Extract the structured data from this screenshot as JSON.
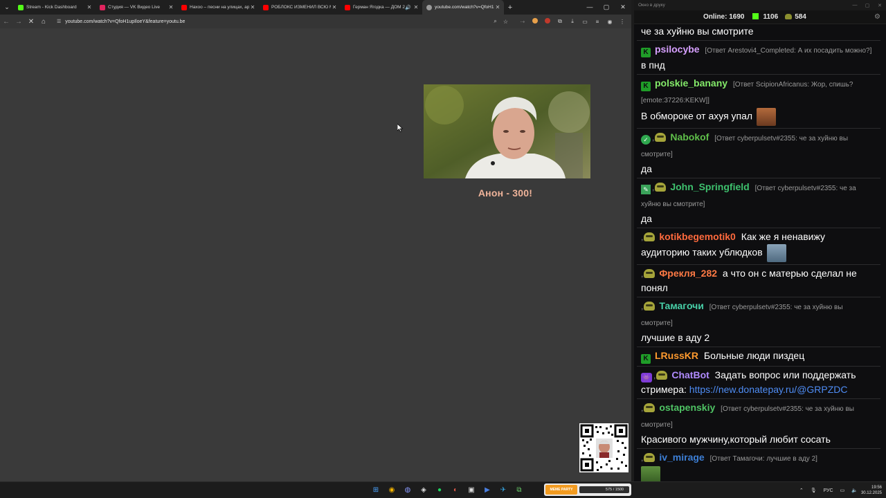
{
  "browser": {
    "tabs": [
      {
        "label": "Stream - Kick Dashboard",
        "favicon_color": "#53fc18"
      },
      {
        "label": "Студия — VK Видео Live",
        "favicon_color": "#e0245e"
      },
      {
        "label": "Нахоо – песни на улицах, арс…",
        "favicon_color": "#ff0000"
      },
      {
        "label": "РОБЛОКС ИЗМЕНИЛ ВСЮ МО…",
        "favicon_color": "#ff0000"
      },
      {
        "label": "Герман Ягодка — ДОМ 2 …",
        "favicon_color": "#ff0000"
      },
      {
        "label": "youtube.com/watch?v=QfoH1…",
        "favicon_color": "#9a9a9a"
      }
    ],
    "url": "youtube.com/watch?v=QfoH1upIloeY&feature=youtu.be",
    "video_caption": "Анон - 300!"
  },
  "chat": {
    "window_title": "Окно в друку",
    "online_label": "Online:",
    "online_count": "1690",
    "kick_count": "1106",
    "frog_count": "584",
    "messages": [
      {
        "text": "че за хуйню вы смотрите"
      },
      {
        "nick": "psilocybe",
        "color": "#d7a0ff",
        "reply": "[Ответ Arestovi4_Completed: А их посадить можно?]",
        "text": "в пнд"
      },
      {
        "nick": "polskie_banany",
        "color": "#84ea6a",
        "reply": "[Ответ ScipionAfricanus: Жор, спишь? [emote:37226:KEKW]]",
        "text": "В обмороке от ахуя упал"
      },
      {
        "nick": "Nabokof",
        "color": "#5fbf4a",
        "reply": "[Ответ cyberpulsetv#2355: че за хуйню вы смотрите]",
        "text": "да"
      },
      {
        "nick": "John_Springfield",
        "color": "#3ec16e",
        "reply": "[Ответ cyberpulsetv#2355: че за хуйню вы смотрите]",
        "text": "да"
      },
      {
        "nick": "kotikbegemotik0",
        "color": "#ff6a3d",
        "text": "Как же я ненавижу аудиторию таких ублюдков"
      },
      {
        "nick": "Фрекля_282",
        "color": "#ff7a45",
        "text": "а что он с матерью сделал не понял"
      },
      {
        "nick": "Тамагочи",
        "color": "#48d0a8",
        "reply": "[Ответ cyberpulsetv#2355: че за хуйню вы смотрите]",
        "text": "лучшие в аду 2"
      },
      {
        "nick": "LRussKR",
        "color": "#ff9a2e",
        "text": "Больные люди пиздец"
      },
      {
        "nick": "ChatBot",
        "color": "#b18cff",
        "text": "Задать вопрос или поддержать стримера:",
        "link": "https://new.donatepay.ru/@GRPZDC"
      },
      {
        "nick": "ostapenskiy",
        "color": "#4fc364",
        "reply": "[Ответ cyberpulsetv#2355: че за хуйню вы смотрите]",
        "text": "Красивого мужчину,который любит сосать"
      },
      {
        "nick": "iv_mirage",
        "color": "#3d7fd6",
        "reply": "[Ответ Тамагочи: лучшие в аду 2]"
      }
    ]
  },
  "taskbar": {
    "widget_badge": "MEME PARTY",
    "widget_progress_text": "575 / 1500",
    "progress_fraction": 0.383,
    "tray_lang": "РУС",
    "time": "19:56",
    "date": "30.12.2025"
  }
}
